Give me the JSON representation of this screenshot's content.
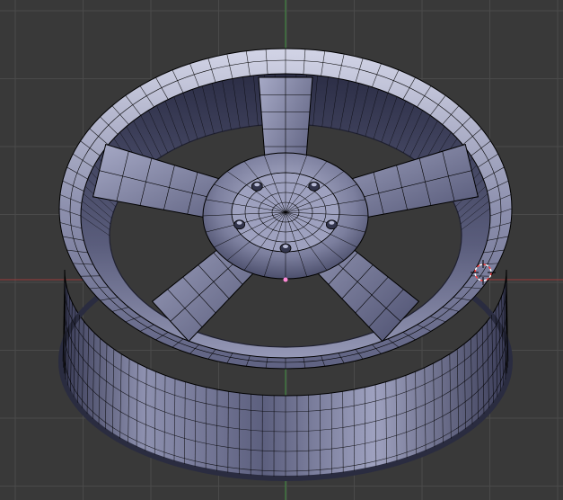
{
  "viewport": {
    "name": "3d-viewport",
    "background": "#393939",
    "grid_color": "#4a4a4a",
    "x_axis_color": "#9a3b3b",
    "y_axis_color": "#3d8f3d",
    "mesh_fill": "#7c7f9c",
    "mesh_dark": "#2e3048",
    "mesh_light": "#c9cbe0",
    "wire_color": "#000000"
  },
  "scene": {
    "object": "wheel-rim-mesh",
    "spoke_count": 5,
    "lug_count": 5,
    "origin_marker_color": "#ff8ad8",
    "cursor_icon": "3d-cursor-icon",
    "cursor_colors": [
      "#ff4040",
      "#ffffff"
    ]
  }
}
